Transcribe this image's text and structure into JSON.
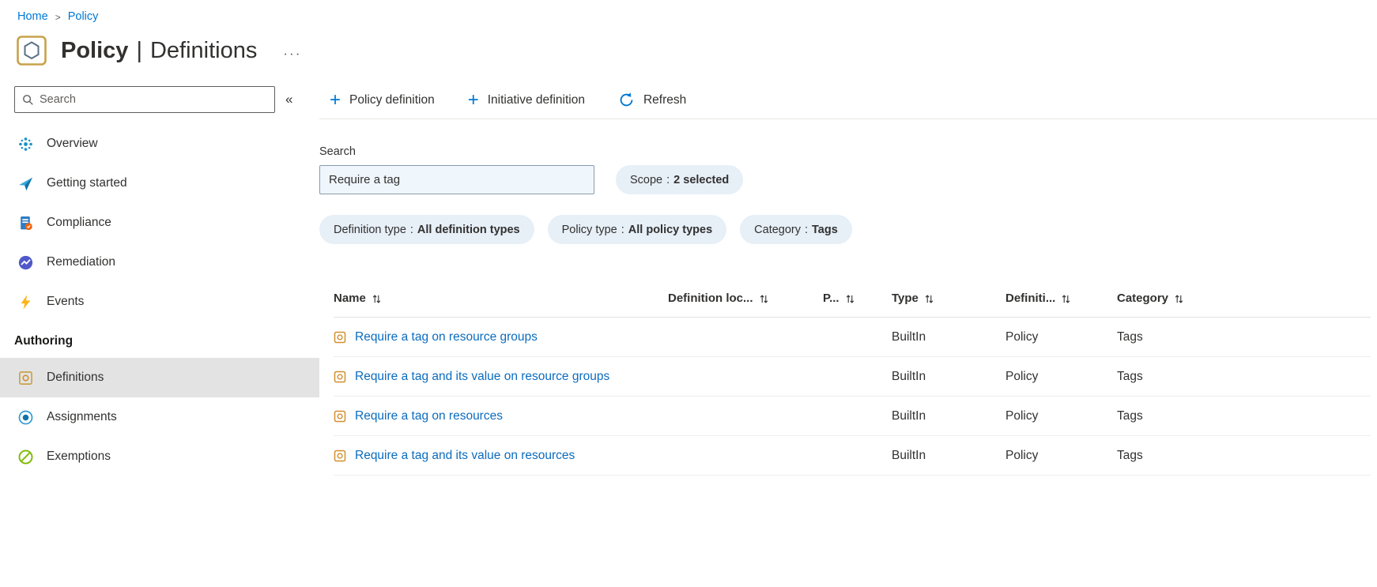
{
  "icons": {
    "chevron_right": ">",
    "ellipsis": "···",
    "collapse": "«",
    "plus": "+"
  },
  "breadcrumb": {
    "home": "Home",
    "policy": "Policy"
  },
  "header": {
    "title": "Policy",
    "separator": "|",
    "subtitle": "Definitions"
  },
  "sidebar": {
    "search_placeholder": "Search",
    "items": [
      {
        "label": "Overview"
      },
      {
        "label": "Getting started"
      },
      {
        "label": "Compliance"
      },
      {
        "label": "Remediation"
      },
      {
        "label": "Events"
      }
    ],
    "section_label": "Authoring",
    "authoring_items": [
      {
        "label": "Definitions",
        "selected": true
      },
      {
        "label": "Assignments",
        "selected": false
      },
      {
        "label": "Exemptions",
        "selected": false
      }
    ]
  },
  "toolbar": {
    "policy_definition_label": "Policy definition",
    "initiative_definition_label": "Initiative definition",
    "refresh_label": "Refresh"
  },
  "filters": {
    "search_label": "Search",
    "search_value": "Require a tag",
    "separator": ":",
    "pills": [
      {
        "label": "Scope",
        "value": "2 selected"
      },
      {
        "label": "Definition type",
        "value": "All definition types"
      },
      {
        "label": "Policy type",
        "value": "All policy types"
      },
      {
        "label": "Category",
        "value": "Tags"
      }
    ]
  },
  "table": {
    "columns": [
      {
        "label": "Name"
      },
      {
        "label": "Definition loc..."
      },
      {
        "label": "P..."
      },
      {
        "label": "Type"
      },
      {
        "label": "Definiti..."
      },
      {
        "label": "Category"
      }
    ],
    "rows": [
      {
        "name": "Require a tag on resource groups",
        "definition_location": "",
        "policies": "",
        "type": "BuiltIn",
        "definition_type": "Policy",
        "category": "Tags"
      },
      {
        "name": "Require a tag and its value on resource groups",
        "definition_location": "",
        "policies": "",
        "type": "BuiltIn",
        "definition_type": "Policy",
        "category": "Tags"
      },
      {
        "name": "Require a tag on resources",
        "definition_location": "",
        "policies": "",
        "type": "BuiltIn",
        "definition_type": "Policy",
        "category": "Tags"
      },
      {
        "name": "Require a tag and its value on resources",
        "definition_location": "",
        "policies": "",
        "type": "BuiltIn",
        "definition_type": "Policy",
        "category": "Tags"
      }
    ]
  },
  "colors": {
    "accent": "#0078d4",
    "link": "#0b6cbe",
    "pill_background": "#e7eff7",
    "search_input_background": "#eff6fc",
    "selected_item_background": "#e3e3e3",
    "text": "#323130",
    "secondary_text": "#605e5c",
    "policy_icon_tan": "#c8a24b",
    "events_yellow": "#fcb514",
    "exemptions_green": "#7fba00"
  }
}
